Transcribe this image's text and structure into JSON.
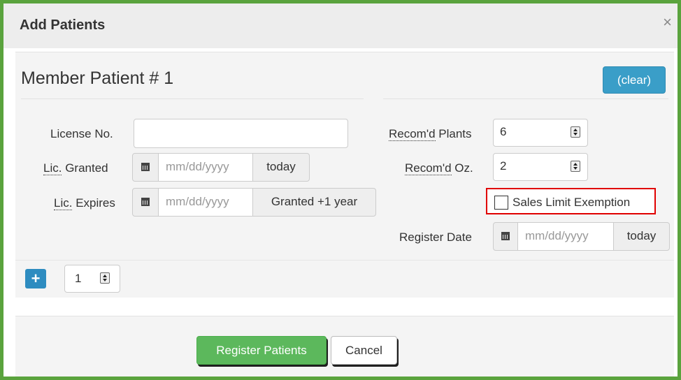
{
  "dialog": {
    "title": "Add Patients",
    "close_glyph": "×"
  },
  "member": {
    "heading": "Member Patient # 1",
    "clear_label": "(clear)"
  },
  "fields": {
    "license_no": {
      "label": "License No.",
      "value": ""
    },
    "lic_granted": {
      "label_abbr": "Lic.",
      "label_rest": " Granted",
      "placeholder": "mm/dd/yyyy",
      "button_label": "today",
      "icon": "calendar-icon"
    },
    "lic_expires": {
      "label_abbr": "Lic.",
      "label_rest": " Expires",
      "placeholder": "mm/dd/yyyy",
      "button_label": "Granted +1 year",
      "icon": "calendar-icon"
    },
    "recom_plants": {
      "label_abbr": "Recom'd",
      "label_rest": " Plants",
      "value": "6"
    },
    "recom_oz": {
      "label_abbr": "Recom'd",
      "label_rest": " Oz.",
      "value": "2"
    },
    "sales_limit_exemption": {
      "label": "Sales Limit Exemption",
      "checked": false,
      "highlight_color": "#e00000"
    },
    "register_date": {
      "label": "Register Date",
      "placeholder": "mm/dd/yyyy",
      "button_label": "today",
      "icon": "calendar-icon"
    }
  },
  "add_bar": {
    "plus_label": "+",
    "count_value": "1"
  },
  "footer": {
    "register_label": "Register Patients",
    "cancel_label": "Cancel"
  },
  "colors": {
    "frame_border": "#5aa33d",
    "clear_button": "#3a9ec8",
    "register_button": "#5cb85c",
    "plus_button": "#2e8cc0"
  }
}
